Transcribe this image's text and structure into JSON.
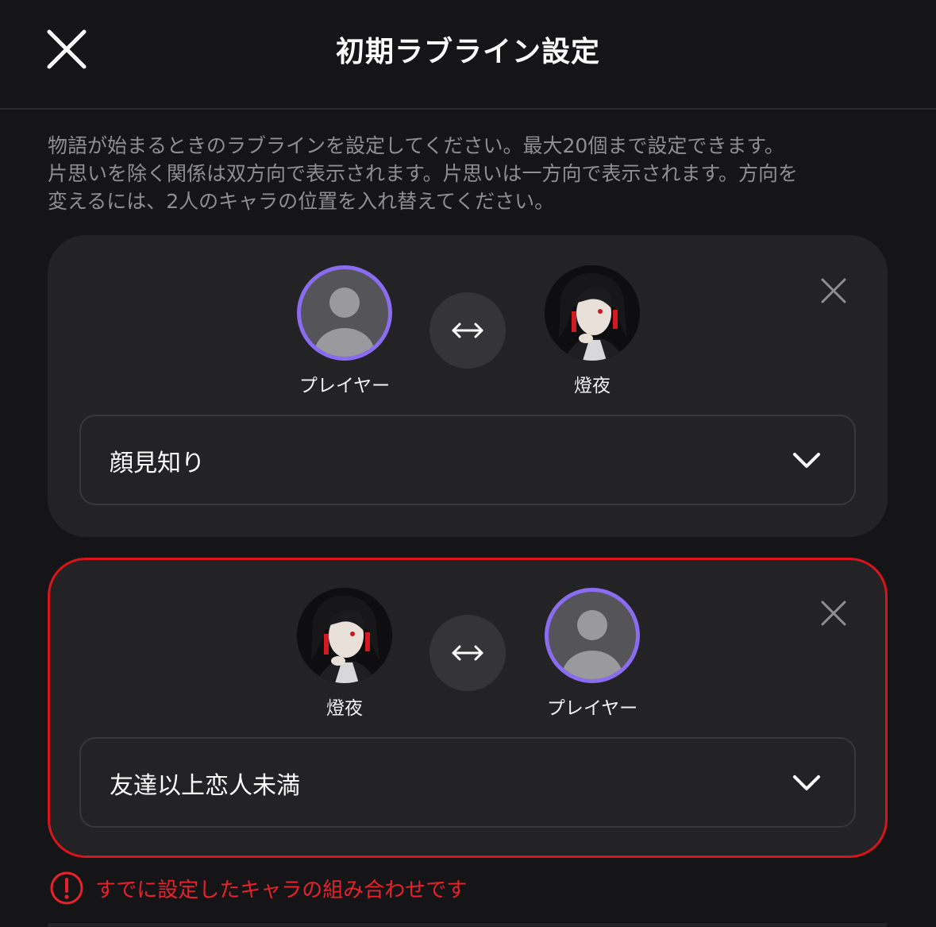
{
  "header": {
    "title": "初期ラブライン設定",
    "close_icon": "close-icon"
  },
  "description": {
    "lines": [
      "物語が始まるときのラブラインを設定してください。最大20個まで設定できます。",
      "片思いを除く関係は双方向で表示されます。片思いは一方向で表示されます。方向を",
      "変えるには、2人のキャラの位置を入れ替えてください。"
    ]
  },
  "lovelines": [
    {
      "left": {
        "name": "プレイヤー",
        "type": "player"
      },
      "right": {
        "name": "燈夜",
        "type": "character"
      },
      "direction_icon": "left-right-arrow-icon",
      "relation": "顔見知り",
      "error": false
    },
    {
      "left": {
        "name": "燈夜",
        "type": "character"
      },
      "right": {
        "name": "プレイヤー",
        "type": "player"
      },
      "direction_icon": "left-right-arrow-icon",
      "relation": "友達以上恋人未満",
      "error": true
    }
  ],
  "error_message": "すでに設定したキャラの組み合わせです",
  "colors": {
    "background": "#151517",
    "card": "#232325",
    "player_ring": "#8a6cf0",
    "error": "#e8222b",
    "muted_text": "#8e8e93"
  }
}
